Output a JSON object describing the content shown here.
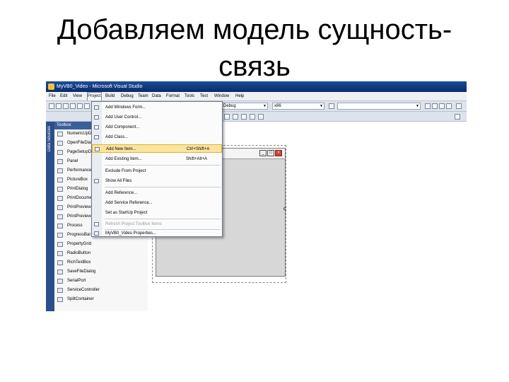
{
  "slide": {
    "title_line1": "Добавляем модель сущность-",
    "title_line2": "связь"
  },
  "window": {
    "title": "MyVB0_Video - Microsoft Visual Studio"
  },
  "menubar": {
    "items": [
      "File",
      "Edit",
      "View",
      "Project",
      "Build",
      "Debug",
      "Team",
      "Data",
      "Format",
      "Tools",
      "Test",
      "Window",
      "Help"
    ]
  },
  "toolbar": {
    "combo1": "Debug",
    "combo2": "x86"
  },
  "toolbox": {
    "header": "Toolbox",
    "strip_label": "Data Sources",
    "items": [
      "NumericUpDown",
      "OpenFileDialog",
      "PageSetupDialog",
      "Panel",
      "PerformanceCounter",
      "PictureBox",
      "PrintDialog",
      "PrintDocument",
      "PrintPreviewControl",
      "PrintPreviewDialog",
      "Process",
      "ProgressBar",
      "PropertyGrid",
      "RadioButton",
      "RichTextBox",
      "SaveFileDialog",
      "SerialPort",
      "ServiceController",
      "SplitContainer"
    ]
  },
  "project_menu": {
    "items": [
      {
        "label": "Add Windows Form...",
        "shortcut": ""
      },
      {
        "label": "Add User Control...",
        "shortcut": ""
      },
      {
        "label": "Add Component...",
        "shortcut": ""
      },
      {
        "label": "Add Class...",
        "shortcut": ""
      },
      {
        "label": "Add New Item...",
        "shortcut": "Ctrl+Shift+A"
      },
      {
        "label": "Add Existing Item...",
        "shortcut": "Shift+Alt+A"
      },
      {
        "label": "Exclude From Project",
        "shortcut": ""
      },
      {
        "label": "Show All Files",
        "shortcut": ""
      },
      {
        "label": "Add Reference...",
        "shortcut": ""
      },
      {
        "label": "Add Service Reference...",
        "shortcut": ""
      },
      {
        "label": "Set as StartUp Project",
        "shortcut": ""
      },
      {
        "label": "Refresh Project Toolbox Items",
        "shortcut": ""
      },
      {
        "label": "MyVB0_Video Properties...",
        "shortcut": ""
      }
    ]
  },
  "design": {
    "stray_char": "c"
  },
  "colors": {
    "titlebar": "#0a2a6a",
    "highlight": "#fbe49c",
    "close_button": "#c8483a"
  }
}
